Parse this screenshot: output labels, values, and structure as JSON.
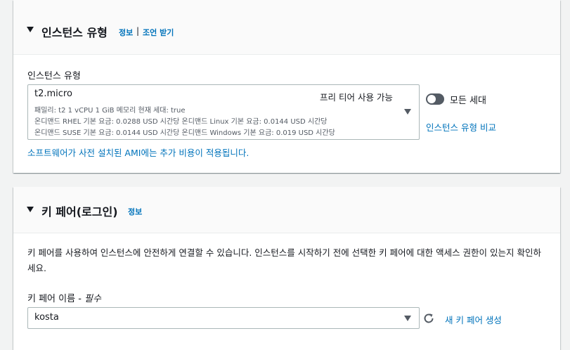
{
  "instance_type_section": {
    "title": "인스턴스 유형",
    "info_link": "정보",
    "separator": "|",
    "advice_link": "조언 받기",
    "field_label": "인스턴스 유형",
    "selected": {
      "name": "t2.micro",
      "tag": "프리 티어 사용 가능",
      "desc_line1": "패밀리: t2    1 vCPU    1 GiB 메모리    현재 세대: true",
      "desc_line2": "온디맨드 RHEL 기본 요금: 0.0288 USD 시간당    온디맨드 Linux 기본 요금: 0.0144 USD 시간당",
      "desc_line3": "온디맨드 SUSE 기본 요금: 0.0144 USD 시간당    온디맨드 Windows 기본 요금: 0.019 USD 시간당"
    },
    "toggle_label": "모든 세대",
    "toggle_on": false,
    "compare_link": "인스턴스 유형 비교",
    "ami_note": "소프트웨어가 사전 설치된 AMI에는 추가 비용이 적용됩니다."
  },
  "key_pair_section": {
    "title": "키 페어(로그인)",
    "info_link": "정보",
    "description": "키 페어를 사용하여 인스턴스에 안전하게 연결할 수 있습니다. 인스턴스를 시작하기 전에 선택한 키 페어에 대한 액세스 권한이 있는지 확인하세요.",
    "field_label": "키 페어 이름 - ",
    "field_required": "필수",
    "selected_value": "kosta",
    "create_link": "새 키 페어 생성"
  },
  "colors": {
    "link": "#0073bb",
    "toggle_off": "#545b64",
    "page_bg": "#f2f3f3"
  },
  "icons": [
    "caret-down-icon",
    "dropdown-arrow-icon",
    "refresh-icon"
  ]
}
